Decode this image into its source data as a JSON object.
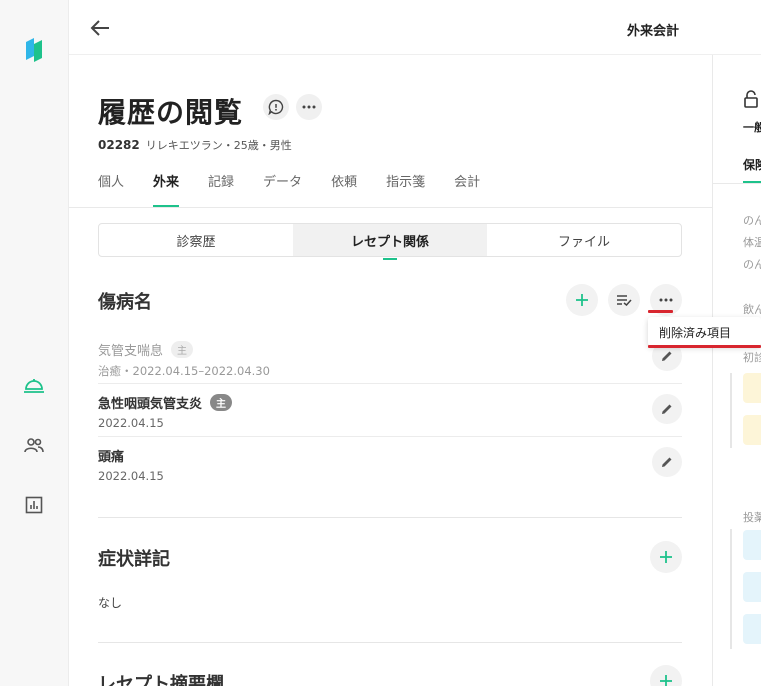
{
  "header": {
    "title": "外来会計"
  },
  "page": {
    "title": "履歴の閲覧",
    "patient_id": "02282",
    "patient_info": "リレキエツラン・25歳・男性"
  },
  "tabs": [
    {
      "label": "個人"
    },
    {
      "label": "外来"
    },
    {
      "label": "記録"
    },
    {
      "label": "データ"
    },
    {
      "label": "依頼"
    },
    {
      "label": "指示箋"
    },
    {
      "label": "会計"
    }
  ],
  "segments": [
    {
      "label": "診察歴"
    },
    {
      "label": "レセプト関係"
    },
    {
      "label": "ファイル"
    }
  ],
  "diagnoses": {
    "title": "傷病名",
    "items": [
      {
        "name": "気管支喘息",
        "badge": "主",
        "date": "治癒・2022.04.15–2022.04.30"
      },
      {
        "name": "急性咽頭気管支炎",
        "badge": "主",
        "date": "2022.04.15"
      },
      {
        "name": "頭痛",
        "date": "2022.04.15"
      }
    ]
  },
  "dropdown": {
    "item": "削除済み項目"
  },
  "symptoms": {
    "title": "症状詳記",
    "value": "なし"
  },
  "receipt_summary": {
    "title": "レセプト摘要欄"
  },
  "right_panel": {
    "label_general": "一般",
    "tab_insurance": "保険",
    "text1": "のん",
    "text2": "体温",
    "text3": "のん",
    "text4": "飲ん",
    "label_initial": "初診",
    "label_admin": "投薬"
  },
  "colors": {
    "accent": "#1ec28b",
    "highlight": "#d8262f"
  }
}
